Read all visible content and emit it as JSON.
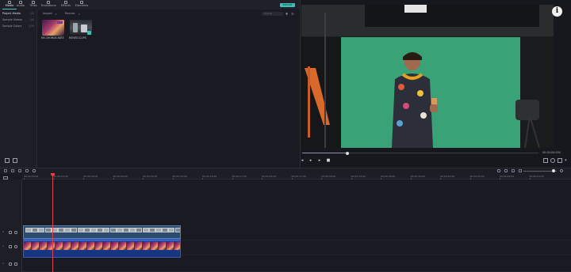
{
  "toolbar": {
    "tabs": [
      {
        "label": "Media",
        "icon": "folder-icon",
        "active": true
      },
      {
        "label": "Audio",
        "icon": "music-note-icon"
      },
      {
        "label": "Titles",
        "icon": "text-icon"
      },
      {
        "label": "Transitions",
        "icon": "transition-icon"
      },
      {
        "label": "Effects",
        "icon": "effects-icon"
      },
      {
        "label": "Elements",
        "icon": "elements-icon"
      }
    ],
    "export_label": "EXPORT"
  },
  "media_tree": {
    "items": [
      {
        "label": "Project Media",
        "count": "(2)",
        "selected": true
      },
      {
        "label": "Sample Videos",
        "count": "(4)"
      },
      {
        "label": "Sample Colors",
        "count": "(15)"
      }
    ]
  },
  "media_panel": {
    "import_label": "Import",
    "record_label": "Record",
    "search_placeholder": "Search",
    "items": [
      {
        "label": "MS CHORDS.RATE"
      },
      {
        "label": "MOVED.CLIPS"
      }
    ]
  },
  "preview": {
    "info_label": "i",
    "timecode": "00:00:00:000",
    "progress": 0.19
  },
  "timeline": {
    "ruler_labels": [
      "00:00:00:00",
      "00:00:03:00",
      "00:00:06:00",
      "00:00:09:00",
      "00:00:12:00",
      "00:00:15:00",
      "00:00:18:00",
      "00:00:21:00",
      "00:00:24:00",
      "00:00:27:00",
      "00:00:30:00",
      "00:00:33:00",
      "00:00:36:00",
      "00:00:39:00",
      "00:00:42:00",
      "00:00:45:00",
      "00:00:48:00",
      "00:00:51:00",
      "00:00:54:00",
      "00:00:57:00"
    ],
    "tracks": [
      "2",
      "1",
      "1"
    ],
    "zoom_level": 0.9
  },
  "colors": {
    "accent": "#3fbfb6",
    "playhead": "#e0414b",
    "audio_clip": "#1f3c8f",
    "video_clip": "#2b4a6e",
    "green_screen": "#3aa277"
  }
}
